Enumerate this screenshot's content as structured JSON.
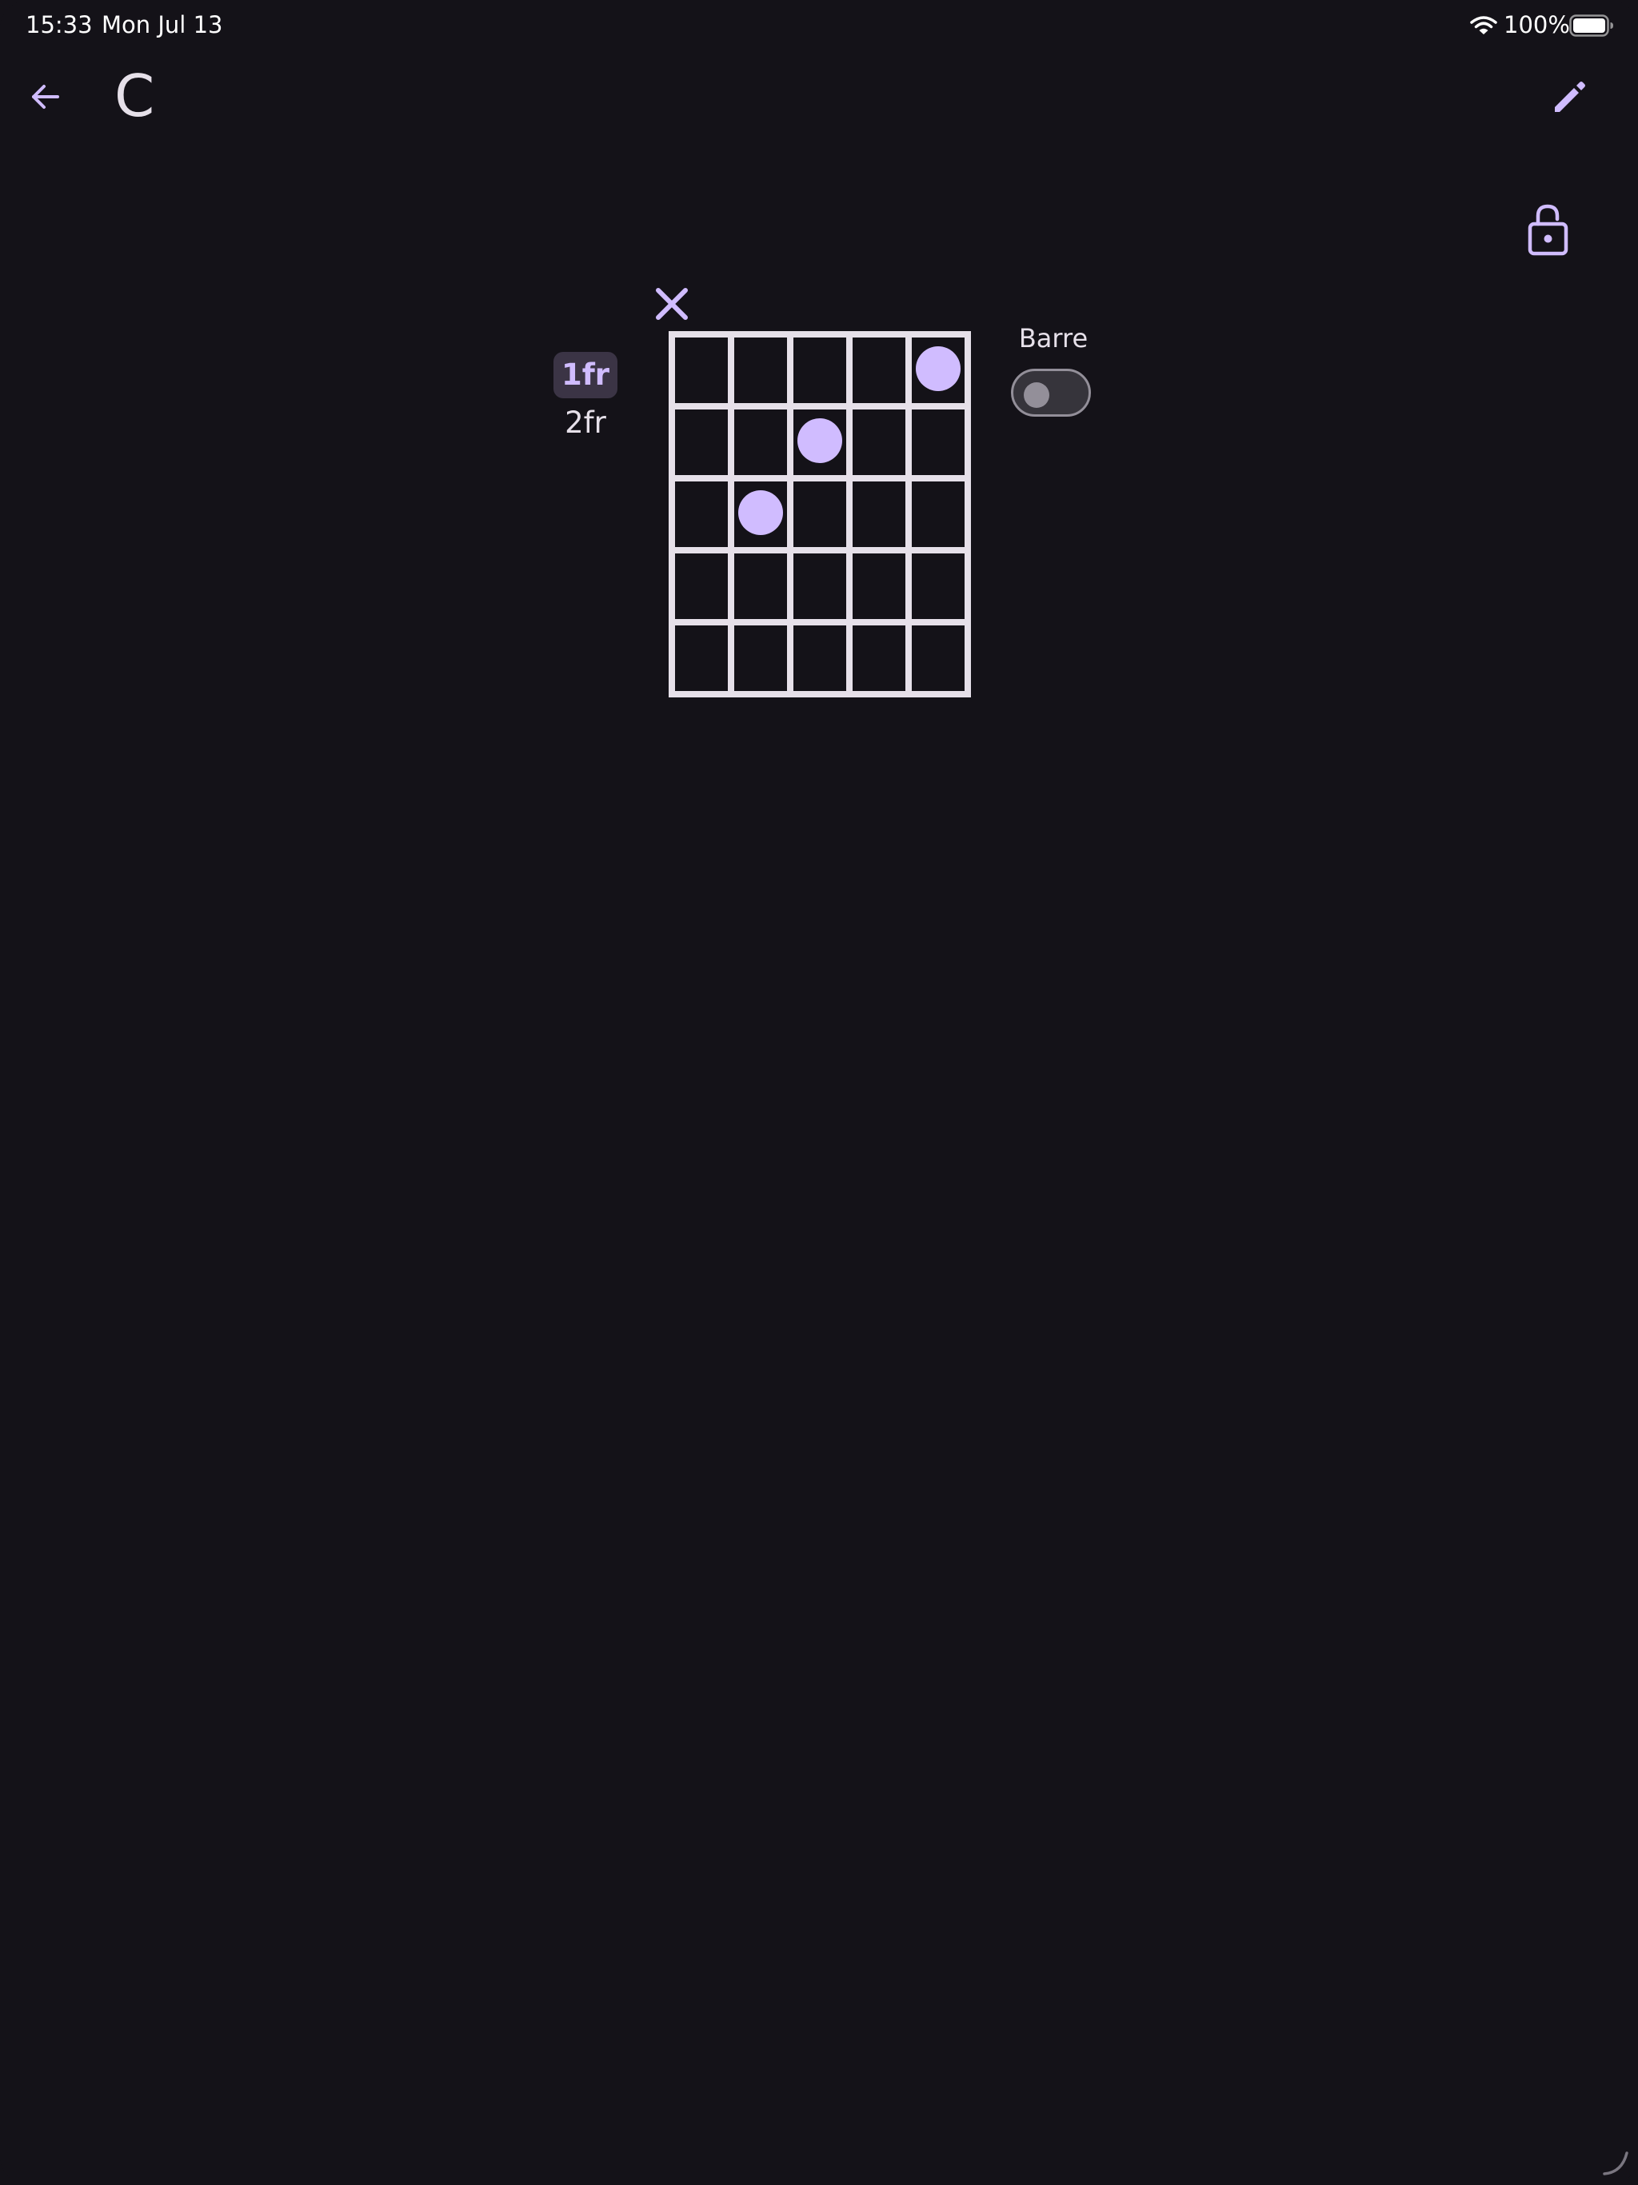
{
  "status_bar": {
    "time": "15:33",
    "date": "Mon Jul 13",
    "battery_percent": "100%",
    "icons": [
      "wifi-icon",
      "battery-icon"
    ]
  },
  "app_bar": {
    "title": "C",
    "icons": [
      "arrow-back-icon",
      "pencil-edit-icon"
    ]
  },
  "lock_icon": "lock-open-icon",
  "fret_selector": {
    "options": [
      {
        "label": "1fr",
        "selected": true
      },
      {
        "label": "2fr",
        "selected": false
      }
    ]
  },
  "chord_diagram": {
    "strings": 6,
    "frets_shown": 5,
    "muted_strings": [
      1
    ],
    "finger_positions": [
      {
        "string": 5,
        "fret": 1
      },
      {
        "string": 3,
        "fret": 2
      },
      {
        "string": 2,
        "fret": 3
      }
    ]
  },
  "barre": {
    "label": "Barre",
    "enabled": false
  },
  "colors": {
    "background": "#141218",
    "accent": "#D0BCFF",
    "grid": "#E6E0E9",
    "selected_chip": "#3B3445",
    "toggle_outline": "#938F99"
  }
}
